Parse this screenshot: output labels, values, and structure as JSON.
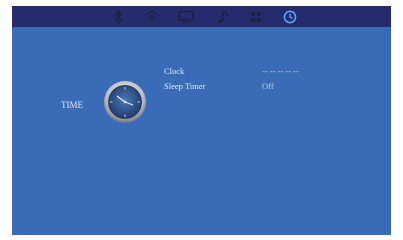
{
  "colors": {
    "screen_bg": "#3a6bb6",
    "topbar_bg": "#262b6e",
    "active_icon": "#5aa8ff",
    "inactive_icon": "#1e2040",
    "text": "#e6eaf5"
  },
  "topbar": {
    "tabs": [
      {
        "icon": "bluetooth-icon",
        "active": false
      },
      {
        "icon": "wifi-icon",
        "active": false
      },
      {
        "icon": "display-icon",
        "active": false
      },
      {
        "icon": "music-note-icon",
        "active": false
      },
      {
        "icon": "apps-icon",
        "active": false
      },
      {
        "icon": "clock-icon",
        "active": true
      }
    ]
  },
  "section": {
    "title": "TIME",
    "icon": "analog-clock-icon"
  },
  "settings": [
    {
      "label": "Clock",
      "value": "-- -- --   -- --"
    },
    {
      "label": "Sleep Timer",
      "value": "Off"
    }
  ]
}
